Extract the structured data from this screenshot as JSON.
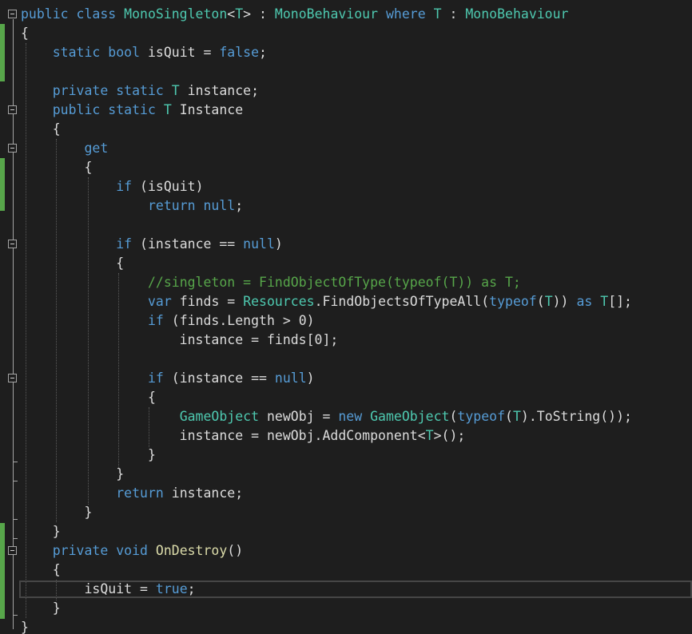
{
  "colors": {
    "background": "#1e1e1e",
    "keyword": "#569cd6",
    "type": "#4ec9b0",
    "plain": "#dcdcdc",
    "comment": "#57a64a",
    "change_marker": "#57a64a"
  },
  "code": {
    "lines": [
      [
        {
          "t": "public class ",
          "c": "kw"
        },
        {
          "t": "MonoSingleton",
          "c": "tp"
        },
        {
          "t": "<",
          "c": "pl"
        },
        {
          "t": "T",
          "c": "tp"
        },
        {
          "t": "> : ",
          "c": "pl"
        },
        {
          "t": "MonoBehaviour ",
          "c": "tp"
        },
        {
          "t": "where ",
          "c": "kw"
        },
        {
          "t": "T",
          "c": "tp"
        },
        {
          "t": " : ",
          "c": "pl"
        },
        {
          "t": "MonoBehaviour",
          "c": "tp"
        }
      ],
      [
        {
          "t": "{",
          "c": "pl"
        }
      ],
      [
        {
          "t": "    ",
          "c": "pl"
        },
        {
          "t": "static bool ",
          "c": "kw"
        },
        {
          "t": "isQuit = ",
          "c": "pl"
        },
        {
          "t": "false",
          "c": "kw"
        },
        {
          "t": ";",
          "c": "pl"
        }
      ],
      [],
      [
        {
          "t": "    ",
          "c": "pl"
        },
        {
          "t": "private static ",
          "c": "kw"
        },
        {
          "t": "T",
          "c": "tp"
        },
        {
          "t": " instance;",
          "c": "pl"
        }
      ],
      [
        {
          "t": "    ",
          "c": "pl"
        },
        {
          "t": "public static ",
          "c": "kw"
        },
        {
          "t": "T",
          "c": "tp"
        },
        {
          "t": " Instance",
          "c": "pl"
        }
      ],
      [
        {
          "t": "    {",
          "c": "pl"
        }
      ],
      [
        {
          "t": "        ",
          "c": "pl"
        },
        {
          "t": "get",
          "c": "kw"
        }
      ],
      [
        {
          "t": "        {",
          "c": "pl"
        }
      ],
      [
        {
          "t": "            ",
          "c": "pl"
        },
        {
          "t": "if ",
          "c": "kw"
        },
        {
          "t": "(isQuit)",
          "c": "pl"
        }
      ],
      [
        {
          "t": "                ",
          "c": "pl"
        },
        {
          "t": "return null",
          "c": "kw"
        },
        {
          "t": ";",
          "c": "pl"
        }
      ],
      [],
      [
        {
          "t": "            ",
          "c": "pl"
        },
        {
          "t": "if ",
          "c": "kw"
        },
        {
          "t": "(instance == ",
          "c": "pl"
        },
        {
          "t": "null",
          "c": "kw"
        },
        {
          "t": ")",
          "c": "pl"
        }
      ],
      [
        {
          "t": "            {",
          "c": "pl"
        }
      ],
      [
        {
          "t": "                ",
          "c": "pl"
        },
        {
          "t": "//singleton = FindObjectOfType(typeof(T)) as T;",
          "c": "cm"
        }
      ],
      [
        {
          "t": "                ",
          "c": "pl"
        },
        {
          "t": "var ",
          "c": "kw"
        },
        {
          "t": "finds = ",
          "c": "pl"
        },
        {
          "t": "Resources",
          "c": "tp"
        },
        {
          "t": ".FindObjectsOfTypeAll(",
          "c": "pl"
        },
        {
          "t": "typeof",
          "c": "kw"
        },
        {
          "t": "(",
          "c": "pl"
        },
        {
          "t": "T",
          "c": "tp"
        },
        {
          "t": ")) ",
          "c": "pl"
        },
        {
          "t": "as ",
          "c": "kw"
        },
        {
          "t": "T",
          "c": "tp"
        },
        {
          "t": "[];",
          "c": "pl"
        }
      ],
      [
        {
          "t": "                ",
          "c": "pl"
        },
        {
          "t": "if ",
          "c": "kw"
        },
        {
          "t": "(finds.Length > 0)",
          "c": "pl"
        }
      ],
      [
        {
          "t": "                    instance = finds[0];",
          "c": "pl"
        }
      ],
      [],
      [
        {
          "t": "                ",
          "c": "pl"
        },
        {
          "t": "if ",
          "c": "kw"
        },
        {
          "t": "(instance == ",
          "c": "pl"
        },
        {
          "t": "null",
          "c": "kw"
        },
        {
          "t": ")",
          "c": "pl"
        }
      ],
      [
        {
          "t": "                {",
          "c": "pl"
        }
      ],
      [
        {
          "t": "                    ",
          "c": "pl"
        },
        {
          "t": "GameObject",
          "c": "tp"
        },
        {
          "t": " newObj = ",
          "c": "pl"
        },
        {
          "t": "new ",
          "c": "kw"
        },
        {
          "t": "GameObject",
          "c": "tp"
        },
        {
          "t": "(",
          "c": "pl"
        },
        {
          "t": "typeof",
          "c": "kw"
        },
        {
          "t": "(",
          "c": "pl"
        },
        {
          "t": "T",
          "c": "tp"
        },
        {
          "t": ").ToString());",
          "c": "pl"
        }
      ],
      [
        {
          "t": "                    instance = newObj.AddComponent<",
          "c": "pl"
        },
        {
          "t": "T",
          "c": "tp"
        },
        {
          "t": ">();",
          "c": "pl"
        }
      ],
      [
        {
          "t": "                }",
          "c": "pl"
        }
      ],
      [
        {
          "t": "            }",
          "c": "pl"
        }
      ],
      [
        {
          "t": "            ",
          "c": "pl"
        },
        {
          "t": "return ",
          "c": "kw"
        },
        {
          "t": "instance;",
          "c": "pl"
        }
      ],
      [
        {
          "t": "        }",
          "c": "pl"
        }
      ],
      [
        {
          "t": "    }",
          "c": "pl"
        }
      ],
      [
        {
          "t": "    ",
          "c": "pl"
        },
        {
          "t": "private void ",
          "c": "kw"
        },
        {
          "t": "OnDestroy",
          "c": "mt"
        },
        {
          "t": "()",
          "c": "pl"
        }
      ],
      [
        {
          "t": "    {",
          "c": "pl"
        }
      ],
      [
        {
          "t": "        isQuit = ",
          "c": "pl"
        },
        {
          "t": "true",
          "c": "kw"
        },
        {
          "t": ";",
          "c": "pl"
        }
      ],
      [
        {
          "t": "    }",
          "c": "pl"
        }
      ],
      [
        {
          "t": "}",
          "c": "pl"
        }
      ]
    ]
  }
}
